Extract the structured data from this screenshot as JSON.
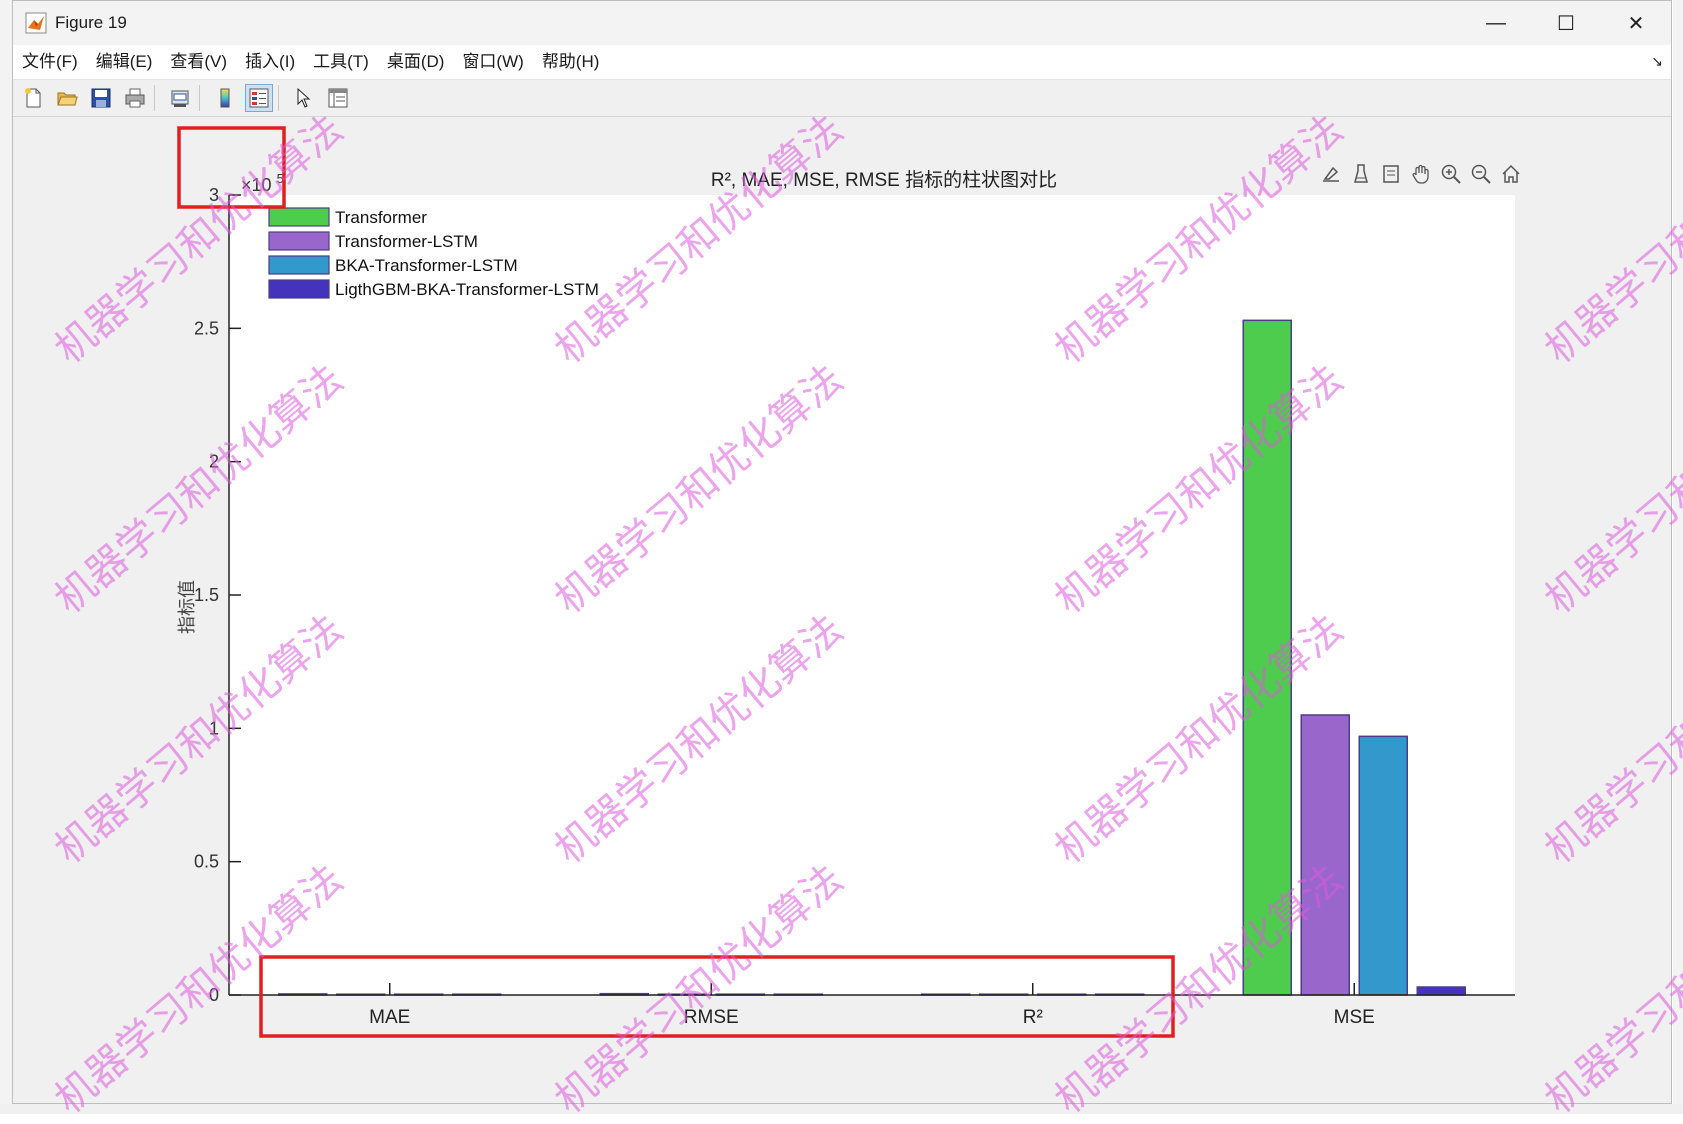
{
  "window": {
    "title": "Figure 19",
    "minimize_glyph": "—",
    "maximize_glyph": "☐",
    "close_glyph": "✕"
  },
  "menu": [
    "文件(F)",
    "编辑(E)",
    "查看(V)",
    "插入(I)",
    "工具(T)",
    "桌面(D)",
    "窗口(W)",
    "帮助(H)"
  ],
  "toolbar_icons": [
    "new-figure-icon",
    "open-icon",
    "save-icon",
    "print-icon",
    "link-plot-icon",
    "colorbar-icon",
    "legend-icon",
    "edit-plot-icon",
    "property-inspector-icon"
  ],
  "axes_toolbar_icons": [
    "brush-icon",
    "data-tips-icon",
    "restore-icon",
    "pan-icon",
    "zoom-in-icon",
    "zoom-out-icon",
    "home-icon"
  ],
  "watermark_text": "机器学习和优化算法",
  "colors": {
    "Transformer": "#4dcc4d",
    "Transformer-LSTM": "#9966cc",
    "BKA-Transformer-LSTM": "#3399cc",
    "LigthGBM-BKA-Transformer-LSTM": "#4433bb",
    "bar_edge": "#4a3d8a",
    "highlight_box": "#e02020"
  },
  "chart_data": {
    "type": "bar",
    "title": "R², MAE, MSE, RMSE 指标的柱状图对比",
    "xlabel": "",
    "ylabel": "指标值",
    "exponent_base": "×10",
    "exponent_power": "5",
    "categories": [
      "MAE",
      "RMSE",
      "R²",
      "MSE"
    ],
    "ylim": [
      0,
      3
    ],
    "yticks": [
      "0",
      "0.5",
      "1",
      "1.5",
      "2",
      "2.5",
      "3"
    ],
    "ytick_values": [
      0,
      0.5,
      1,
      1.5,
      2,
      2.5,
      3
    ],
    "legend_position": "top-left",
    "grid": false,
    "series": [
      {
        "name": "Transformer",
        "values": [
          0.004,
          0.005,
          0.003,
          2.53
        ]
      },
      {
        "name": "Transformer-LSTM",
        "values": [
          0.0025,
          0.003,
          0.003,
          1.05
        ]
      },
      {
        "name": "BKA-Transformer-LSTM",
        "values": [
          0.0024,
          0.0031,
          0.003,
          0.97
        ]
      },
      {
        "name": "LigthGBM-BKA-Transformer-LSTM",
        "values": [
          0.0005,
          0.0006,
          0.003,
          0.03
        ]
      }
    ]
  }
}
